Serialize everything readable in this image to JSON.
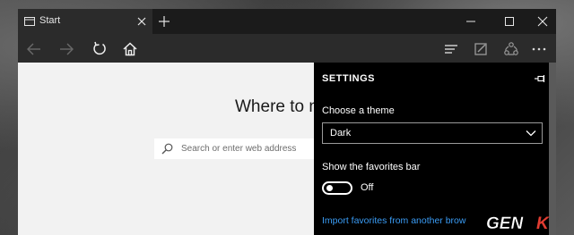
{
  "tab": {
    "title": "Start"
  },
  "page": {
    "hero_text": "Where to ne",
    "search_placeholder": "Search or enter web address"
  },
  "settings": {
    "title": "SETTINGS",
    "theme_label": "Choose a theme",
    "theme_value": "Dark",
    "favorites_label": "Show the favorites bar",
    "favorites_toggle": "Off",
    "favorites_toggle_on": false,
    "import_link": "Import favorites from another brow"
  },
  "watermark": {
    "text": "GENK"
  },
  "colors": {
    "link": "#3a9cf5",
    "watermark": "#e03c31",
    "pane": "#000000",
    "page": "#f2f2f2"
  },
  "icons": [
    "tab-page-icon",
    "close-icon",
    "plus-icon",
    "minimize-icon",
    "maximize-icon",
    "close-icon",
    "back-arrow-icon",
    "forward-arrow-icon",
    "refresh-icon",
    "home-icon",
    "hub-icon",
    "web-note-icon",
    "share-icon",
    "more-icon",
    "search-icon",
    "pin-icon",
    "chevron-down-icon"
  ]
}
